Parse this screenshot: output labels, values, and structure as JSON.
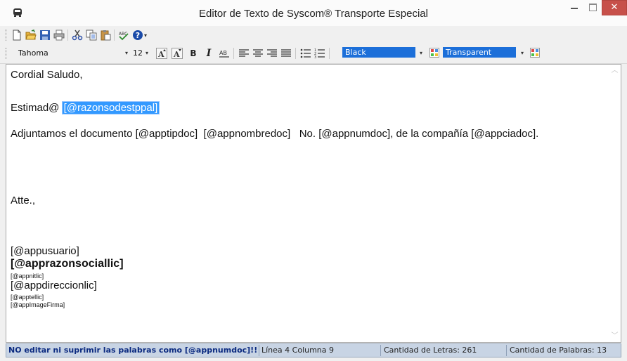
{
  "window": {
    "title": "Editor de Texto de Syscom® Transporte Especial",
    "close_glyph": "✕"
  },
  "toolbar": {
    "font_name": "Tahoma",
    "font_size": "12",
    "bold_label": "B",
    "italic_label": "I",
    "text_color": "Black",
    "back_color": "Transparent",
    "dropdown_arrow": "▾"
  },
  "editor": {
    "greeting": "Cordial Saludo,",
    "estimado_prefix": "Estimad@ ",
    "estimado_field": "[@razonsodestppal]",
    "body_line": "Adjuntamos el documento [@apptipdoc]  [@appnombredoc]   No. [@appnumdoc], de la compañía [@appciadoc].",
    "closing": "Atte.,",
    "signature_user": "[@appusuario]",
    "signature_company": "[@apprazonsociallic]",
    "signature_nit": "[@appnitlic]",
    "signature_address": "[@appdireccionlic]",
    "signature_phone": "[@apptellic]",
    "signature_image": "[@appImageFirma]"
  },
  "scrollbar": {
    "up_arrow": "︿",
    "down_arrow": "﹀"
  },
  "status": {
    "warning": "NO editar ni suprimir las palabras como [@appnumdoc]!!",
    "position": "Línea 4 Columna 9",
    "letters": "Cantidad de Letras: 261",
    "words": "Cantidad de Palabras: 13"
  },
  "colors": {
    "accent": "#1c6fd9",
    "close_button": "#c7504a",
    "statusbar": "#c8d4e4",
    "warning_text": "#0b2a80"
  },
  "icons": [
    "new-document-icon",
    "open-folder-icon",
    "save-icon",
    "print-icon",
    "cut-icon",
    "copy-icon",
    "paste-icon",
    "spellcheck-icon",
    "help-icon",
    "grow-font-icon",
    "shrink-font-icon",
    "bold-icon",
    "italic-icon",
    "underline-icon",
    "align-left-icon",
    "align-center-icon",
    "align-right-icon",
    "justify-icon",
    "bullets-icon",
    "numbering-icon",
    "color-palette-icon"
  ]
}
